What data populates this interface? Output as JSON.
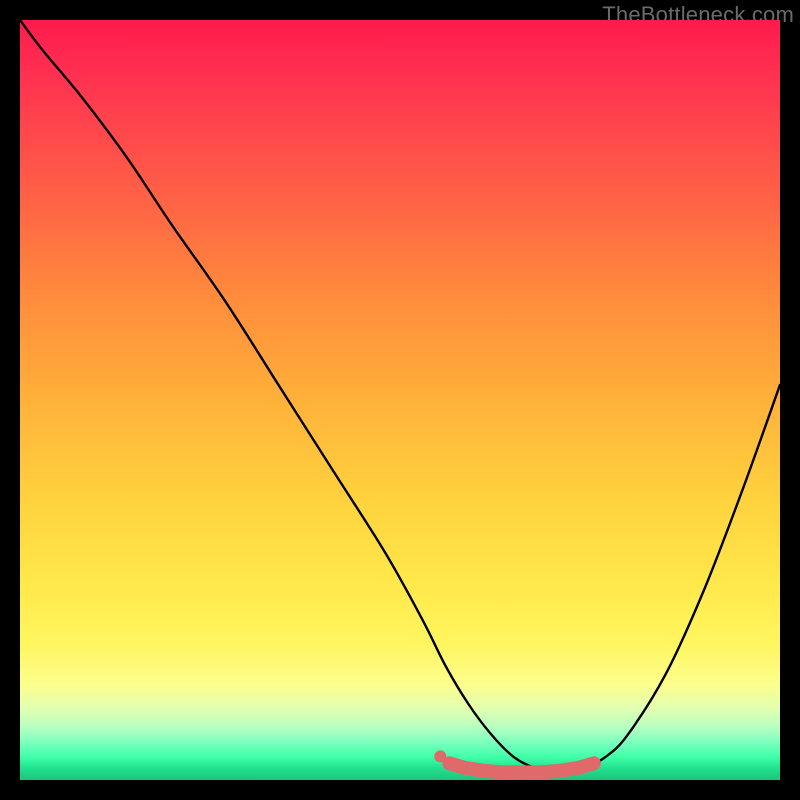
{
  "watermark": "TheBottleneck.com",
  "colors": {
    "curve_stroke": "#000000",
    "marker_fill": "#e0696a",
    "frame_bg": "#000000"
  },
  "chart_data": {
    "type": "line",
    "title": "",
    "xlabel": "",
    "ylabel": "",
    "xlim": [
      0,
      100
    ],
    "ylim": [
      0,
      100
    ],
    "grid": false,
    "legend": false,
    "series": [
      {
        "name": "bottleneck-curve",
        "x": [
          0,
          3,
          8,
          14,
          20,
          27,
          34,
          41,
          48,
          53,
          56,
          59,
          62,
          65,
          68,
          71,
          74,
          77,
          80,
          85,
          90,
          95,
          100
        ],
        "y": [
          100,
          96,
          90,
          82,
          73,
          63,
          52,
          41,
          30,
          21,
          15,
          10,
          6,
          3,
          1.5,
          1,
          1.5,
          3,
          6,
          14,
          25,
          38,
          52
        ]
      }
    ],
    "markers": {
      "name": "flat-bottom-band",
      "x": [
        56.5,
        58.5,
        61,
        63.5,
        66,
        68.5,
        71,
        73.5,
        75.5
      ],
      "y": [
        2.2,
        1.6,
        1.2,
        1.0,
        1.0,
        1.0,
        1.2,
        1.6,
        2.2
      ]
    },
    "gradient_stops": [
      {
        "pos": 0.0,
        "color": "#ff1a4e"
      },
      {
        "pos": 0.08,
        "color": "#ff3350"
      },
      {
        "pos": 0.22,
        "color": "#ff5d47"
      },
      {
        "pos": 0.36,
        "color": "#ff8a3c"
      },
      {
        "pos": 0.5,
        "color": "#ffb13a"
      },
      {
        "pos": 0.63,
        "color": "#ffd23e"
      },
      {
        "pos": 0.74,
        "color": "#ffe84a"
      },
      {
        "pos": 0.82,
        "color": "#fff65f"
      },
      {
        "pos": 0.875,
        "color": "#fcfe8d"
      },
      {
        "pos": 0.905,
        "color": "#e3ffb0"
      },
      {
        "pos": 0.93,
        "color": "#b7ffc0"
      },
      {
        "pos": 0.95,
        "color": "#7dffbf"
      },
      {
        "pos": 0.97,
        "color": "#3effa8"
      },
      {
        "pos": 0.985,
        "color": "#21e08e"
      },
      {
        "pos": 1.0,
        "color": "#1cc47c"
      }
    ]
  }
}
